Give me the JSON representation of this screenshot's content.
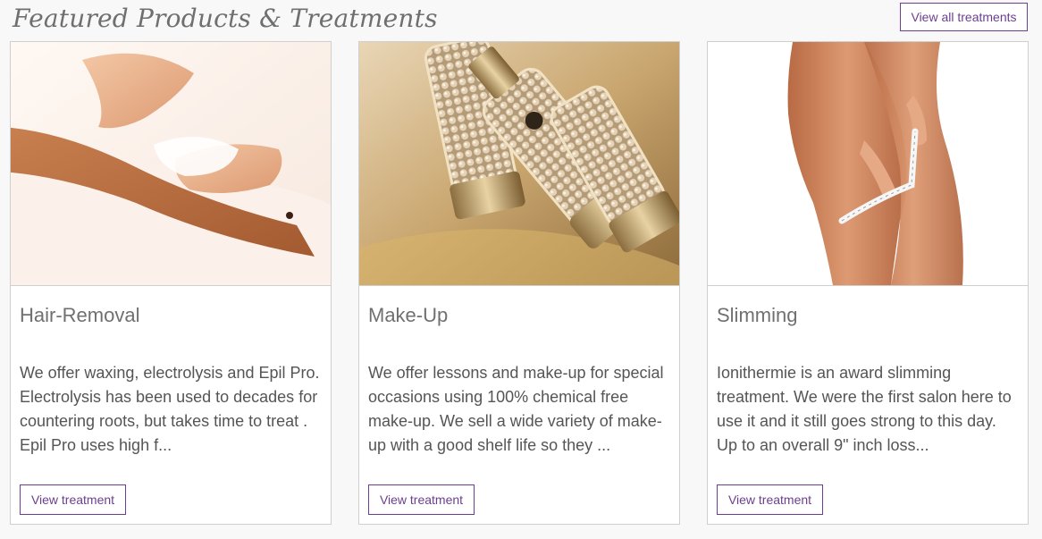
{
  "header": {
    "title": "Featured Products & Treatments",
    "view_all_label": "View all treatments",
    "accent_color": "#6b3f8e"
  },
  "cards": [
    {
      "image_icon": "hair-removal-photo",
      "title": "Hair-Removal",
      "description": "We offer waxing, electrolysis and Epil Pro. Electrolysis has been used to decades for countering roots, but takes time to treat . Epil Pro uses high f...",
      "button_label": "View treatment"
    },
    {
      "image_icon": "make-up-photo",
      "title": "Make-Up",
      "description": "We offer lessons and make-up for special occasions using 100% chemical free make-up. We sell a wide variety of make-up with a good shelf life so they ...",
      "button_label": "View treatment"
    },
    {
      "image_icon": "slimming-photo",
      "title": "Slimming",
      "description": "Ionithermie is an award slimming treatment. We were the first salon here to use it and it still goes strong to this day. Up to an overall 9\" inch loss...",
      "button_label": "View treatment"
    }
  ]
}
